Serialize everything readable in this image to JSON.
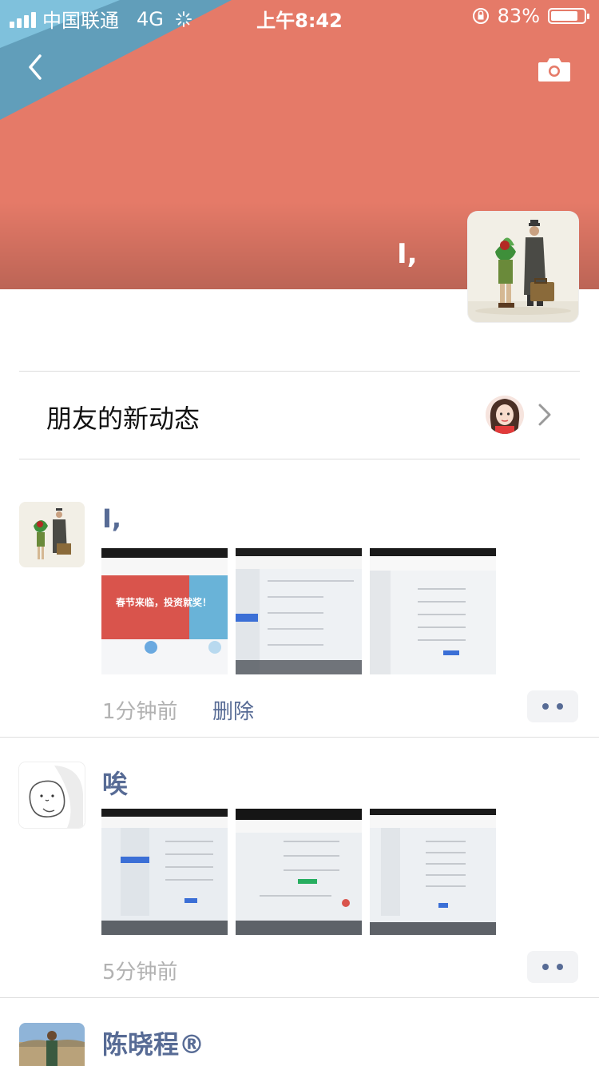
{
  "status_bar": {
    "carrier": "中国联通",
    "network": "4G",
    "time": "上午8:42",
    "battery_percent": "83%",
    "battery_level": 0.83
  },
  "header": {
    "back_icon": "chevron-left-icon",
    "camera_icon": "camera-icon",
    "cover_name": "I,",
    "colors": {
      "cover": "#e57a68",
      "cover_accent": "#5aa0bf"
    }
  },
  "friends_updates": {
    "label": "朋友的新动态",
    "icon": "chevron-right-icon"
  },
  "posts": [
    {
      "name": "I,",
      "time": "1分钟前",
      "delete_label": "删除",
      "thumbs": [
        {
          "banner": "春节来临，投资就奖！"
        },
        {},
        {}
      ]
    },
    {
      "name": "唉",
      "time": "5分钟前",
      "thumbs": [
        {},
        {},
        {}
      ]
    },
    {
      "name": "陈晓程®"
    }
  ],
  "colors": {
    "link": "#576b95",
    "meta": "#b2b2b2"
  }
}
